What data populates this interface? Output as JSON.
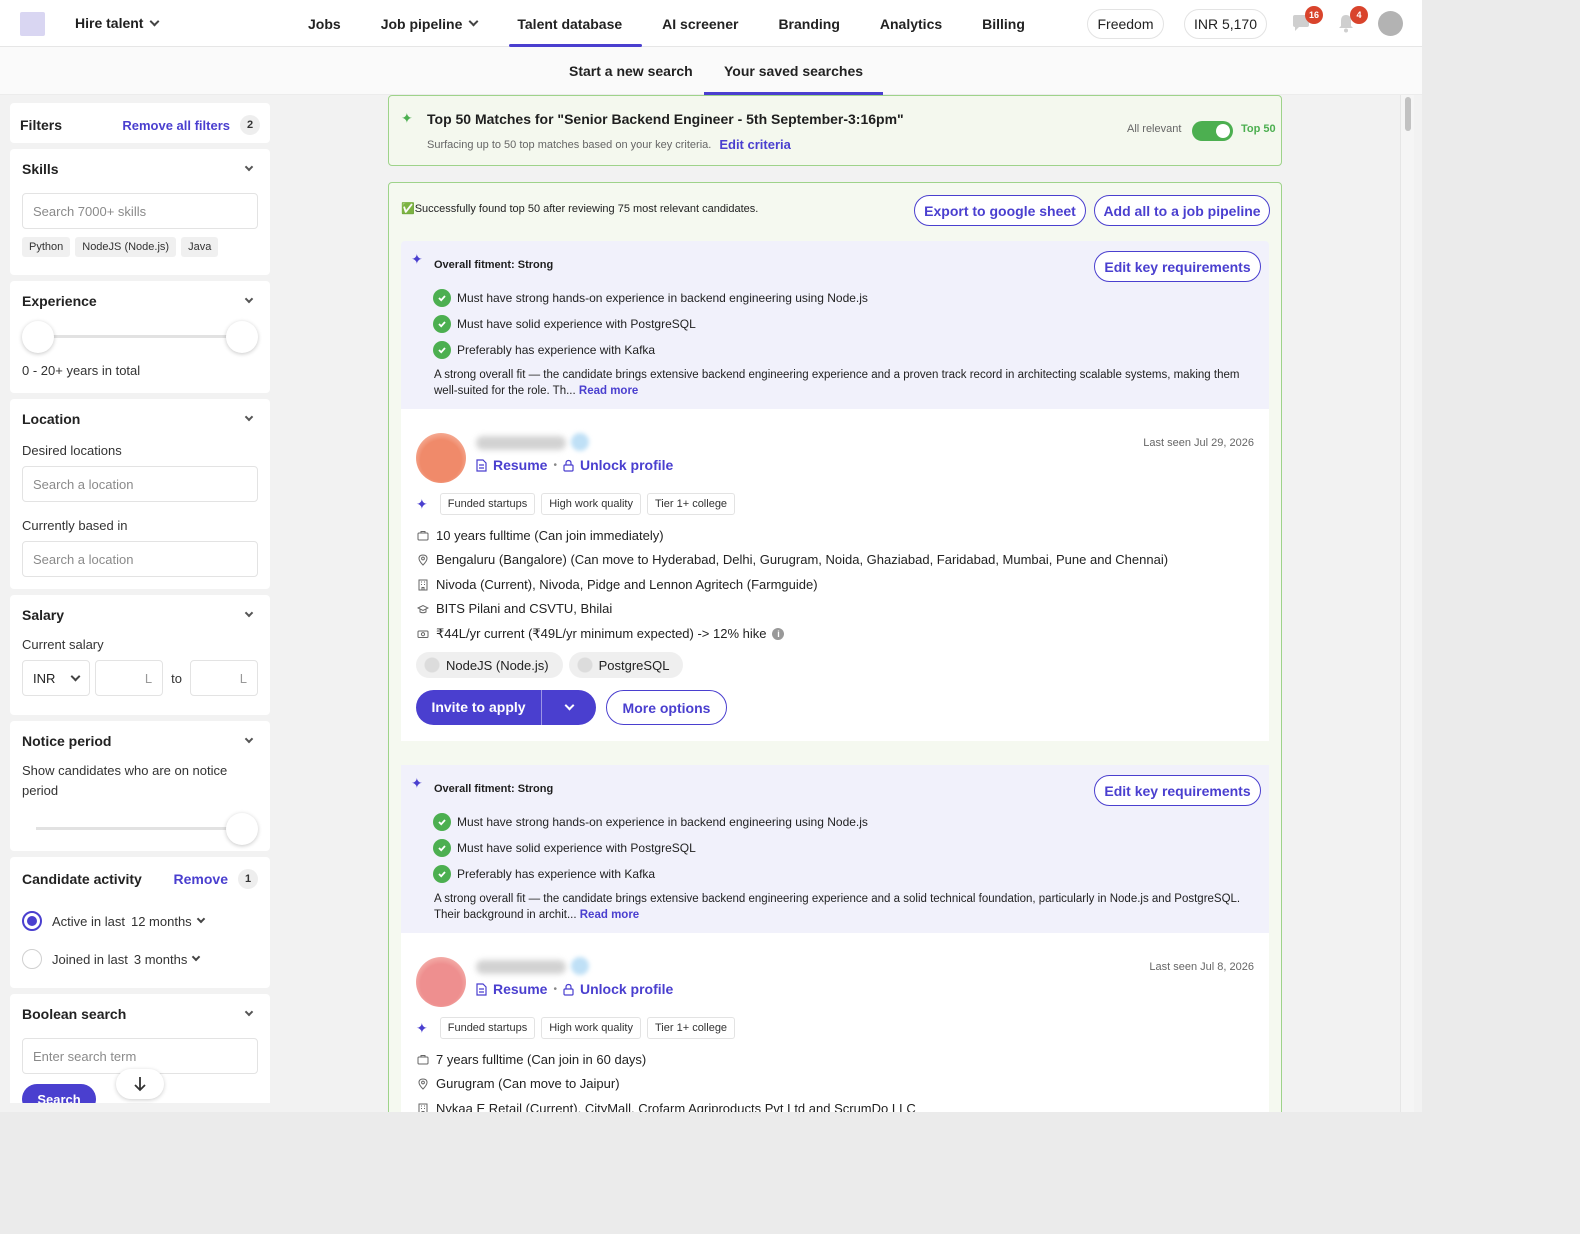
{
  "topnav": {
    "hire_label": "Hire talent",
    "links": [
      {
        "label": "Jobs"
      },
      {
        "label": "Job pipeline"
      },
      {
        "label": "Talent database"
      },
      {
        "label": "AI screener"
      },
      {
        "label": "Branding"
      },
      {
        "label": "Analytics"
      },
      {
        "label": "Billing"
      }
    ],
    "plan": "Freedom",
    "credits": "INR 5,170",
    "messages_count": "16",
    "notifications_count": "4"
  },
  "subnav": {
    "new_search": "Start a new search",
    "saved_searches": "Your saved searches"
  },
  "filters": {
    "title": "Filters",
    "remove_all": "Remove all filters",
    "count": "2",
    "skills": {
      "title": "Skills",
      "placeholder": "Search 7000+ skills",
      "chips": [
        "Python",
        "NodeJS (Node.js)",
        "Java"
      ]
    },
    "experience": {
      "title": "Experience",
      "range_text": "0 - 20+ years in total"
    },
    "location": {
      "title": "Location",
      "desired_label": "Desired locations",
      "desired_placeholder": "Search a location",
      "current_label": "Currently based in",
      "current_placeholder": "Search a location"
    },
    "salary": {
      "title": "Salary",
      "current_label": "Current salary",
      "currency": "INR",
      "unit": "L",
      "to": "to"
    },
    "notice": {
      "title": "Notice period",
      "text": "Show candidates who are on notice period"
    },
    "activity": {
      "title": "Candidate activity",
      "remove": "Remove",
      "count": "1",
      "option1_prefix": "Active in last",
      "option1_value": "12 months",
      "option2_prefix": "Joined in last",
      "option2_value": "3 months"
    },
    "boolean": {
      "title": "Boolean search",
      "placeholder": "Enter search term",
      "button": "Search"
    }
  },
  "banner": {
    "title": "Top 50 Matches for \"Senior Backend Engineer - 5th September-3:16pm\"",
    "subtitle": "Surfacing up to 50 top matches based on your key criteria.",
    "edit_criteria": "Edit criteria",
    "toggle_left": "All relevant",
    "toggle_right": "Top 50"
  },
  "results": {
    "status_icon": "✅",
    "status": "Successfully found top 50 after reviewing 75 most relevant candidates.",
    "export": "Export to google sheet",
    "add_all": "Add all to a job pipeline"
  },
  "common": {
    "edit_key_req": "Edit key requirements",
    "resume": "Resume",
    "unlock": "Unlock profile",
    "separator": "•",
    "read_more": "Read more",
    "invite": "Invite to apply",
    "more_options": "More options"
  },
  "candidates": [
    {
      "fitment": "Overall fitment: Strong",
      "requirements": [
        "Must have strong hands-on experience in backend engineering using Node.js",
        "Must have solid experience with PostgreSQL",
        "Preferably has experience with Kafka"
      ],
      "summary": "A strong overall fit — the candidate brings extensive backend engineering experience and a proven track record in architecting scalable systems, making them well-suited for the role. Th...",
      "last_seen": "Last seen Jul 29, 2026",
      "tags": [
        "Funded startups",
        "High work quality",
        "Tier 1+ college"
      ],
      "experience": "10 years fulltime (Can join immediately)",
      "location": "Bengaluru (Bangalore)",
      "relocation": "(Can move to Hyderabad, Delhi, Gurugram, Noida, Ghaziabad, Faridabad, Mumbai, Pune and Chennai)",
      "companies": "Nivoda (Current), Nivoda, Pidge and Lennon Agritech (Farmguide)",
      "education": "BITS Pilani and CSVTU, Bhilai",
      "salary": "₹44L/yr current (₹49L/yr minimum expected) -> 12% hike",
      "skills": [
        "NodeJS (Node.js)",
        "PostgreSQL"
      ],
      "avatar_color": "#f08a6a"
    },
    {
      "fitment": "Overall fitment: Strong",
      "requirements": [
        "Must have strong hands-on experience in backend engineering using Node.js",
        "Must have solid experience with PostgreSQL",
        "Preferably has experience with Kafka"
      ],
      "summary": "A strong overall fit — the candidate brings extensive backend engineering experience and a solid technical foundation, particularly in Node.js and PostgreSQL. Their background in archit...",
      "last_seen": "Last seen Jul 8, 2026",
      "tags": [
        "Funded startups",
        "High work quality",
        "Tier 1+ college"
      ],
      "experience": "7 years fulltime (Can join in 60 days)",
      "location": "Gurugram",
      "relocation": "(Can move to Jaipur)",
      "companies": "Nykaa E Retail (Current), CityMall, Crofarm Agriproducts Pvt Ltd and ScrumDo LLC",
      "avatar_color": "#ee8f8f"
    }
  ],
  "colors": {
    "accent": "#4a3fcf",
    "success": "#4caf50",
    "badge": "#d9442c"
  }
}
